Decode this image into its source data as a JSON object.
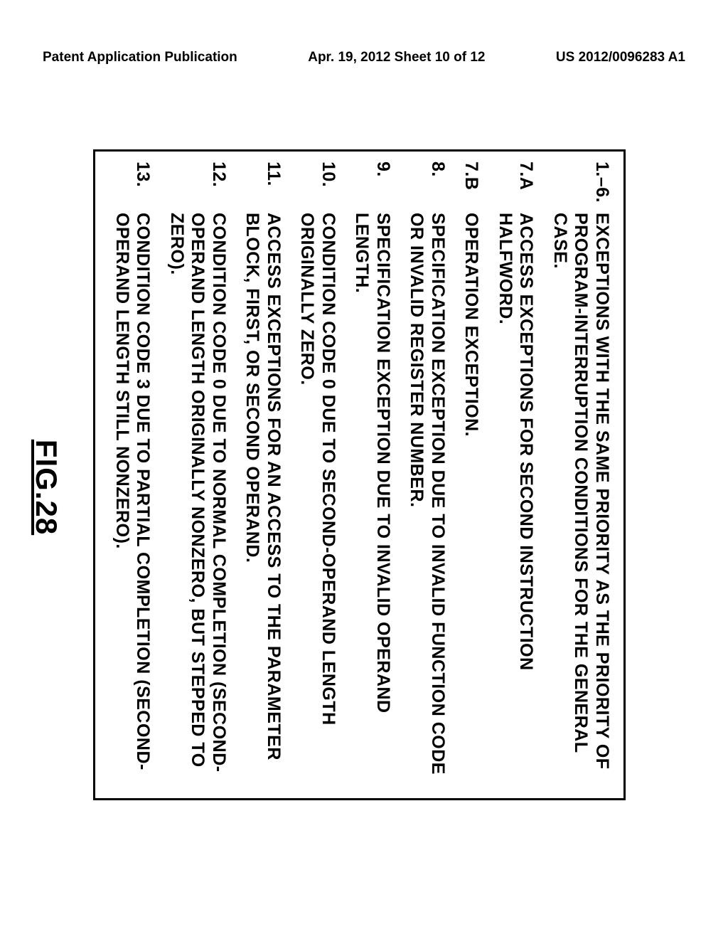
{
  "header": {
    "left": "Patent Application Publication",
    "mid": "Apr. 19, 2012  Sheet 10 of 12",
    "right": "US 2012/0096283 A1"
  },
  "figure_label": "FIG.28",
  "rows": [
    {
      "num": "1.–6.",
      "text": "EXCEPTIONS WITH THE SAME PRIORITY AS THE PRIORITY OF PROGRAM-INTERRUPTION CONDITIONS FOR THE GENERAL CASE."
    },
    {
      "num": "7.A",
      "text": "ACCESS EXCEPTIONS FOR SECOND INSTRUCTION HALFWORD."
    },
    {
      "num": "7.B",
      "text": "OPERATION EXCEPTION."
    },
    {
      "num": "8.",
      "text": "SPECIFICATION EXCEPTION DUE TO INVALID FUNCTION CODE OR INVALID REGISTER NUMBER."
    },
    {
      "num": "9.",
      "text": "SPECIFICATION EXCEPTION DUE TO INVALID OPERAND LENGTH."
    },
    {
      "num": "10.",
      "text": "CONDITION CODE 0 DUE TO SECOND-OPERAND LENGTH ORIGINALLY ZERO."
    },
    {
      "num": "11.",
      "text": "ACCESS EXCEPTIONS FOR AN ACCESS TO THE PARAMETER BLOCK, FIRST, OR SECOND OPERAND."
    },
    {
      "num": "12.",
      "text": "CONDITION CODE 0 DUE TO NORMAL COMPLETION (SECOND-OPERAND LENGTH ORIGINALLY NONZERO, BUT STEPPED TO ZERO)."
    },
    {
      "num": "13.",
      "text": "CONDITION CODE 3 DUE TO PARTIAL COMPLETION (SECOND-OPERAND LENGTH STILL NONZERO)."
    }
  ]
}
